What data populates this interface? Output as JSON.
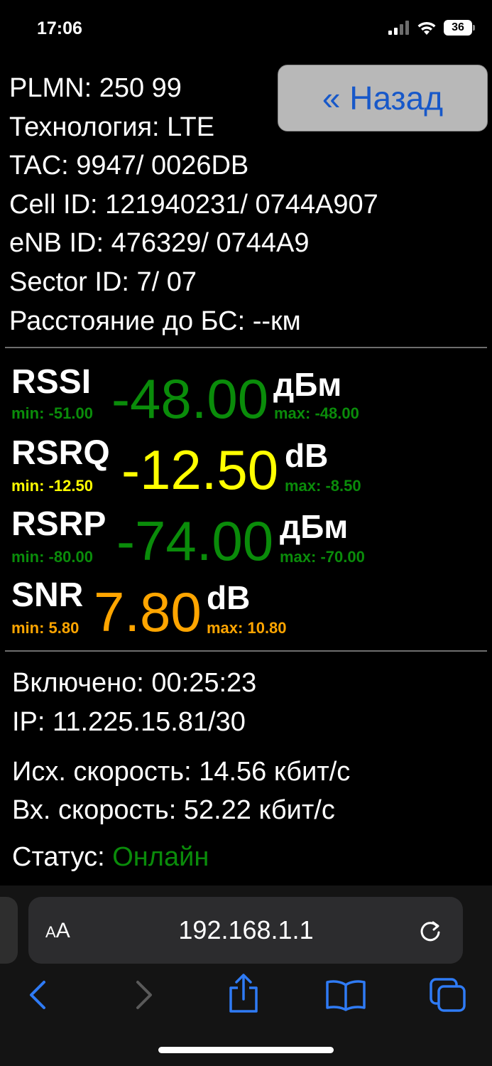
{
  "status_bar": {
    "time": "17:06",
    "battery": "36"
  },
  "info": {
    "plmn": "PLMN: 250 99",
    "technology": "Технология: LTE",
    "tac": "TAC: 9947/ 0026DB",
    "cell_id": "Cell ID: 121940231/ 0744A907",
    "enb_id": "eNB ID: 476329/ 0744A9",
    "sector_id": "Sector ID: 7/ 07",
    "distance": "Расстояние до БС: --км"
  },
  "back_button": "« Назад",
  "metrics": {
    "rssi": {
      "name": "RSSI",
      "value": "-48.00",
      "unit": "дБм",
      "min": "min: -51.00",
      "max": "max: -48.00",
      "color": "#0a8c0a"
    },
    "rsrq": {
      "name": "RSRQ",
      "value": "-12.50",
      "unit": "dB",
      "min": "min: -12.50",
      "max": "max: -8.50",
      "color": "#ffff00",
      "min_color": "#ffff00",
      "max_color": "#0a8c0a"
    },
    "rsrp": {
      "name": "RSRP",
      "value": "-74.00",
      "unit": "дБм",
      "min": "min: -80.00",
      "max": "max: -70.00",
      "color": "#0a8c0a"
    },
    "snr": {
      "name": "SNR",
      "value": "7.80",
      "unit": "dB",
      "min": "min: 5.80",
      "max": "max: 10.80",
      "color": "#ffa500"
    }
  },
  "session": {
    "uptime": "Включено: 00:25:23",
    "ip": "IP: 11.225.15.81/30",
    "upload": "Исх. скорость: 14.56 кбит/с",
    "download": "Вх. скорость: 52.22 кбит/с",
    "status_label": "Статус: ",
    "status_value": "Онлайн",
    "status_color": "#0a8c0a"
  },
  "browser": {
    "text_size_small": "A",
    "text_size_large": "A",
    "url": "192.168.1.1",
    "icons": [
      "reload-icon",
      "back-icon",
      "forward-icon",
      "share-icon",
      "bookmarks-icon",
      "tabs-icon"
    ]
  }
}
